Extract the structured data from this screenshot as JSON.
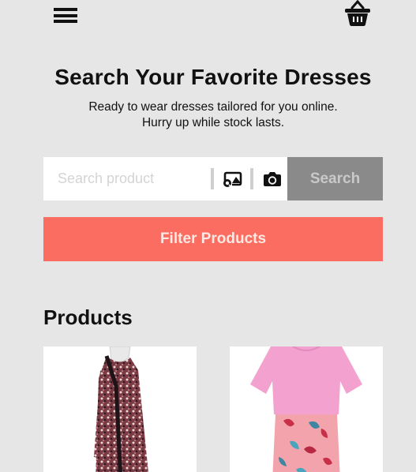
{
  "header": {
    "menu_icon": "hamburger-menu-icon",
    "cart_icon": "shopping-basket-icon"
  },
  "hero": {
    "title": "Search Your Favorite Dresses",
    "subtitle_line1": "Ready to wear dresses tailored for you online.",
    "subtitle_line2": "Hurry up while stock lasts."
  },
  "search": {
    "placeholder": "Search product",
    "value": "",
    "image_search_icon": "image-search-icon",
    "camera_icon": "camera-icon",
    "button_label": "Search"
  },
  "filter": {
    "button_label": "Filter Products"
  },
  "products": {
    "heading": "Products",
    "items": [
      {
        "image": "patterned-long-sleeve-dress"
      },
      {
        "image": "pink-top-floral-dress"
      }
    ]
  },
  "colors": {
    "background": "#e6e6e6",
    "filter_button": "#fa6d60",
    "search_button": "#8a8a8a"
  }
}
